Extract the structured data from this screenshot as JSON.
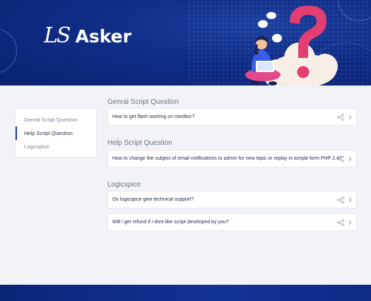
{
  "header": {
    "logo_mark": "LS",
    "brand": "Asker"
  },
  "sidebar": {
    "items": [
      {
        "label": "Genral Script Question",
        "active": false
      },
      {
        "label": "Help Script Question",
        "active": true
      },
      {
        "label": "Logicspice",
        "active": false
      }
    ]
  },
  "sections": [
    {
      "title": "Genral Script Question",
      "questions": [
        "How to get flash working on ckeditor?"
      ]
    },
    {
      "title": "Help Script Question",
      "questions": [
        "How to change the subject of email notifications to admin for new topic or replay in simple form PHP 2.4?"
      ]
    },
    {
      "title": "Logicspice",
      "questions": [
        "Do logicspice give technical support?",
        "Will i get refund if i dont like script developed by you?"
      ]
    }
  ],
  "icons": {
    "share": "share-icon",
    "chevron": "chevron-right-icon"
  },
  "colors": {
    "header_bg": "#0f2c86",
    "accent": "#1e3a8a",
    "question_mark": "#e23e71",
    "page_bg": "#f1f3f7"
  }
}
